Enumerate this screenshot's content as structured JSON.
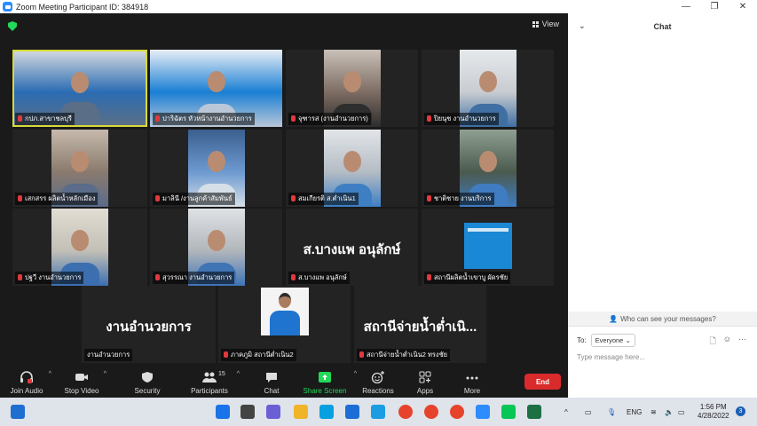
{
  "window": {
    "title": "Zoom Meeting Participant ID: 384918",
    "min": "—",
    "max": "❐",
    "close": "✕"
  },
  "meeting": {
    "view_label": "View",
    "tiles": [
      {
        "name": "กปภ.สาขาชลบุรี",
        "active": true,
        "kind": "video",
        "colors": [
          "#2b6cb3",
          "#cfd6df",
          "#5a6f87"
        ]
      },
      {
        "name": "ปาริฉัตร หัวหน้างานอำนวยการ",
        "kind": "video",
        "colors": [
          "#1a7fd4",
          "#e8eef6",
          "#b9c7d8"
        ]
      },
      {
        "name": "จุฑารส (งานอำนวยการ)",
        "kind": "video",
        "colors": [
          "#7d6d63",
          "#c9c0b8",
          "#2e2e2e"
        ]
      },
      {
        "name": "ปิยนุช งานอำนวยการ",
        "kind": "video",
        "colors": [
          "#c8ccd0",
          "#e6e9ec",
          "#3f6fa3"
        ]
      },
      {
        "name": "เสกสรร ผลิตน้ำหลักเมือง",
        "kind": "video",
        "colors": [
          "#8a7a6e",
          "#c7b9ad",
          "#5a6c8a"
        ]
      },
      {
        "name": "มาลินี /งานลูกค้าสัมพันธ์",
        "kind": "video",
        "colors": [
          "#6e9ad1",
          "#3a5f8f",
          "#d6dfe8"
        ]
      },
      {
        "name": "สมเกียรติ ส.ต่ำเนิน1",
        "kind": "video",
        "colors": [
          "#b4bcc4",
          "#e2e5e8",
          "#3e7fc4"
        ]
      },
      {
        "name": "ชาติชาย งานบริการ",
        "kind": "video",
        "colors": [
          "#4b5a4e",
          "#8fa092",
          "#3f7cc2"
        ]
      },
      {
        "name": "ปฐวี งานอำนวยการ",
        "kind": "video",
        "colors": [
          "#c2bfb6",
          "#e1ddd3",
          "#3b6fb0"
        ]
      },
      {
        "name": "สุวรรณา งานอำนวยการ",
        "kind": "video",
        "colors": [
          "#b1b6bb",
          "#dfe2e5",
          "#3f74b5"
        ]
      },
      {
        "name": "ส.บางแพ อนุลักษ์",
        "kind": "text",
        "big": "ส.บางแพ อนุลักษ์"
      },
      {
        "name": "สถานีผลิตน้ำเขาบู ผัดรชัย",
        "kind": "poster",
        "colors": [
          "#1b88d6",
          "#ffffff"
        ]
      },
      {
        "name": "งานอำนวยการ",
        "kind": "text",
        "big": "งานอำนวยการ"
      },
      {
        "name": "ภาคภูมิ สถานีต่ำเนิน2",
        "kind": "portrait",
        "colors": [
          "#f4f4f4",
          "#1f74d0",
          "#2c2c2c"
        ]
      },
      {
        "name": "สถานีจ่ายน้ำต่ำเนิน2 ทรงชัย",
        "kind": "text",
        "big": "สถานีจ่ายน้ำต่ำเนิ..."
      }
    ]
  },
  "toolbar": {
    "join_audio": "Join Audio",
    "stop_video": "Stop Video",
    "security": "Security",
    "participants": "Participants",
    "participants_count": "15",
    "chat": "Chat",
    "share_screen": "Share Screen",
    "reactions": "Reactions",
    "apps": "Apps",
    "more": "More",
    "end": "End",
    "accent_share": "#23d959",
    "accent_end": "#d92b2b"
  },
  "chat": {
    "title": "Chat",
    "who_can_see": "Who can see your messages?",
    "to_label": "To:",
    "to_value": "Everyone",
    "placeholder": "Type message here..."
  },
  "taskbar": {
    "lang": "ENG",
    "time": "1:56 PM",
    "date": "4/28/2022",
    "notifications": "3"
  }
}
